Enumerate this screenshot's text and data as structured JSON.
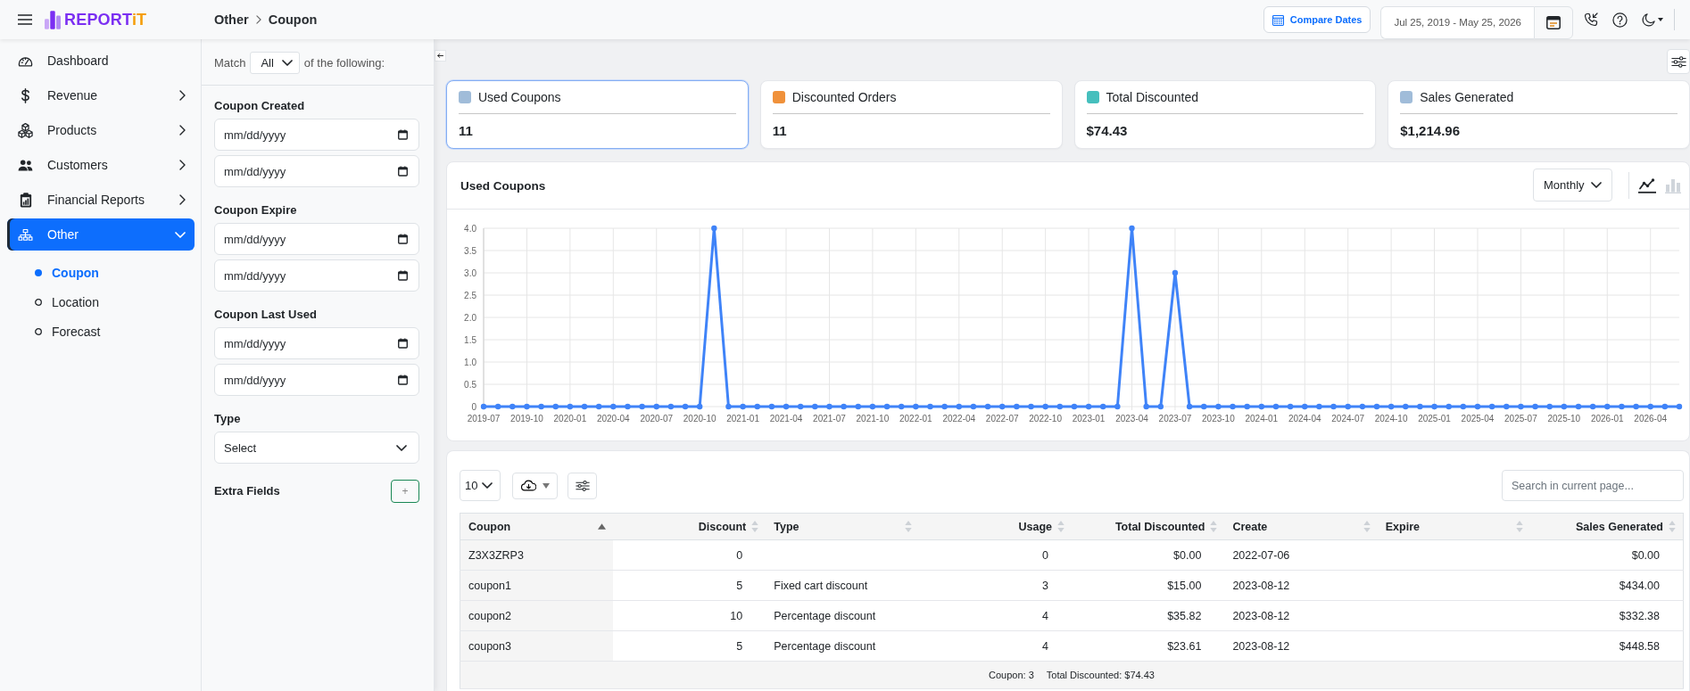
{
  "header": {
    "brand": {
      "name": "REPORT",
      "suffix": "iT"
    },
    "breadcrumb": [
      "Other",
      "Coupon"
    ],
    "compare_button": "Compare Dates",
    "date_range": "Jul 25, 2019 - May 25, 2026"
  },
  "sidebar": {
    "items": [
      {
        "label": "Dashboard",
        "kind": "link",
        "expanded": false,
        "selected": false
      },
      {
        "label": "Revenue",
        "kind": "group",
        "expanded": false,
        "selected": false
      },
      {
        "label": "Products",
        "kind": "group",
        "expanded": false,
        "selected": false
      },
      {
        "label": "Customers",
        "kind": "group",
        "expanded": false,
        "selected": false
      },
      {
        "label": "Financial Reports",
        "kind": "group",
        "expanded": false,
        "selected": false
      },
      {
        "label": "Other",
        "kind": "group",
        "expanded": true,
        "selected": true,
        "children": [
          {
            "label": "Coupon",
            "selected": true
          },
          {
            "label": "Location",
            "selected": false
          },
          {
            "label": "Forecast",
            "selected": false
          }
        ]
      }
    ]
  },
  "filters": {
    "match": {
      "label": "Match",
      "value": "All",
      "suffix": "of the following:"
    },
    "groups": [
      {
        "label": "Coupon Created",
        "kind": "date_range",
        "fields": [
          {
            "placeholder": "mm/dd/yyyy"
          },
          {
            "placeholder": "mm/dd/yyyy"
          }
        ]
      },
      {
        "label": "Coupon Expire",
        "kind": "date_range",
        "fields": [
          {
            "placeholder": "mm/dd/yyyy"
          },
          {
            "placeholder": "mm/dd/yyyy"
          }
        ]
      },
      {
        "label": "Coupon Last Used",
        "kind": "date_range",
        "fields": [
          {
            "placeholder": "mm/dd/yyyy"
          },
          {
            "placeholder": "mm/dd/yyyy"
          }
        ]
      },
      {
        "label": "Type",
        "kind": "select",
        "value": "Select"
      }
    ],
    "extra_fields": {
      "label": "Extra Fields",
      "button": "+"
    }
  },
  "cards": [
    {
      "label": "Used Coupons",
      "value": "11",
      "color": "#a0bcd9",
      "selected": true
    },
    {
      "label": "Discounted Orders",
      "value": "11",
      "color": "#f0913a",
      "selected": false
    },
    {
      "label": "Total Discounted",
      "value": "$74.43",
      "color": "#45bfbd",
      "selected": false
    },
    {
      "label": "Sales Generated",
      "value": "$1,214.96",
      "color": "#a0bcd9",
      "selected": false
    }
  ],
  "chart_panel": {
    "title": "Used Coupons",
    "period": "Monthly",
    "views": [
      {
        "kind": "line",
        "selected": true
      },
      {
        "kind": "bar",
        "selected": false
      }
    ],
    "chart_data": {
      "type": "line",
      "grid": true,
      "marker": true,
      "categories": [
        "2019-07",
        null,
        null,
        "2019-10",
        null,
        null,
        "2020-01",
        null,
        null,
        "2020-04",
        null,
        null,
        "2020-07",
        null,
        null,
        "2020-10",
        null,
        null,
        "2021-01",
        null,
        null,
        "2021-04",
        null,
        null,
        "2021-07",
        null,
        null,
        "2021-10",
        null,
        null,
        "2022-01",
        null,
        null,
        "2022-04",
        null,
        null,
        "2022-07",
        null,
        null,
        "2022-10",
        null,
        null,
        "2023-01",
        null,
        null,
        "2023-04",
        null,
        null,
        "2023-07",
        null,
        null,
        "2023-10",
        null,
        null,
        "2024-01",
        null,
        null,
        "2024-04",
        null,
        null,
        "2024-07",
        null,
        null,
        "2024-10",
        null,
        null,
        "2025-01",
        null,
        null,
        "2025-04",
        null,
        null,
        "2025-07",
        null,
        null,
        "2025-10",
        null,
        null,
        "2026-01",
        null,
        null,
        "2026-04",
        null,
        null
      ],
      "values": [
        0,
        0,
        0,
        0,
        0,
        0,
        0,
        0,
        0,
        0,
        0,
        0,
        0,
        0,
        0,
        0,
        4,
        0,
        0,
        0,
        0,
        0,
        0,
        0,
        0,
        0,
        0,
        0,
        0,
        0,
        0,
        0,
        0,
        0,
        0,
        0,
        0,
        0,
        0,
        0,
        0,
        0,
        0,
        0,
        0,
        4,
        0,
        0,
        3,
        0,
        0,
        0,
        0,
        0,
        0,
        0,
        0,
        0,
        0,
        0,
        0,
        0,
        0,
        0,
        0,
        0,
        0,
        0,
        0,
        0,
        0,
        0,
        0,
        0,
        0,
        0,
        0,
        0,
        0,
        0,
        0,
        0,
        0,
        0
      ],
      "ylim": [
        0,
        4
      ],
      "yticks": [
        {
          "value": 0,
          "label": "0"
        },
        {
          "value": 0.5,
          "label": "0.5"
        },
        {
          "value": 1,
          "label": "1.0"
        },
        {
          "value": 1.5,
          "label": "1.5"
        },
        {
          "value": 2,
          "label": "2.0"
        },
        {
          "value": 2.5,
          "label": "2.5"
        },
        {
          "value": 3,
          "label": "3.0"
        },
        {
          "value": 3.5,
          "label": "3.5"
        },
        {
          "value": 4,
          "label": "4.0"
        }
      ]
    }
  },
  "table_panel": {
    "page_size": "10",
    "search": {
      "placeholder": "Search in current page..."
    },
    "columns": [
      {
        "label": "Coupon",
        "kind": "text",
        "sorted": true
      },
      {
        "label": "Discount",
        "kind": "number",
        "sorted": false
      },
      {
        "label": "Type",
        "kind": "text",
        "sorted": false
      },
      {
        "label": "Usage",
        "kind": "number",
        "sorted": false
      },
      {
        "label": "Total Discounted",
        "kind": "number",
        "sorted": false
      },
      {
        "label": "Create",
        "kind": "text",
        "sorted": false
      },
      {
        "label": "Expire",
        "kind": "text",
        "sorted": false
      },
      {
        "label": "Sales Generated",
        "kind": "number",
        "sorted": false
      }
    ],
    "rows": [
      [
        "Z3X3ZRP3",
        "0",
        null,
        "0",
        "$0.00",
        "2022-07-06",
        null,
        "$0.00"
      ],
      [
        "coupon1",
        "5",
        "Fixed cart discount",
        "3",
        "$15.00",
        "2023-08-12",
        null,
        "$434.00"
      ],
      [
        "coupon2",
        "10",
        "Percentage discount",
        "4",
        "$35.82",
        "2023-08-12",
        null,
        "$332.38"
      ],
      [
        "coupon3",
        "5",
        "Percentage discount",
        "4",
        "$23.61",
        "2023-08-12",
        null,
        "$448.58"
      ]
    ],
    "footer": [
      "Coupon: 3",
      "Total Discounted: $74.43"
    ]
  }
}
